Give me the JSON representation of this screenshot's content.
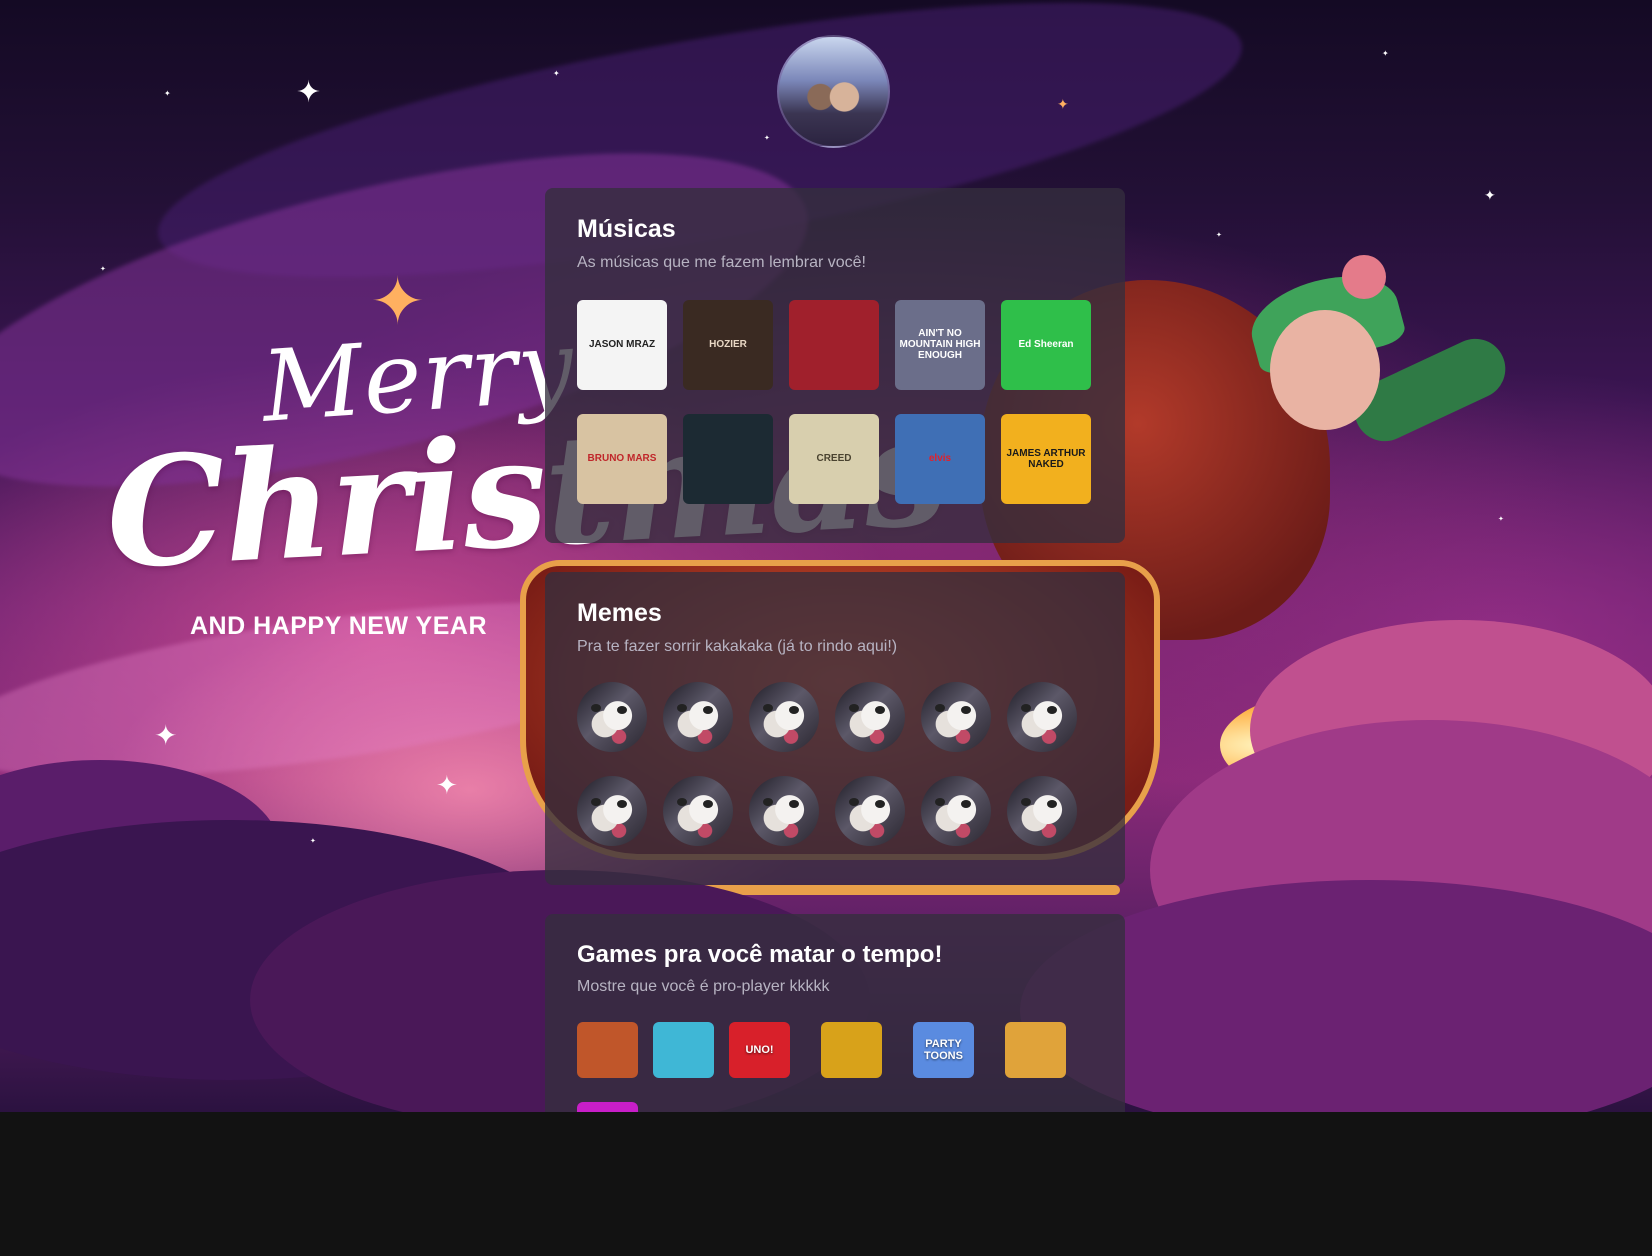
{
  "greeting": {
    "merry": "Merry",
    "christmas": "Christmas",
    "new_year": "AND HAPPY NEW YEAR"
  },
  "avatar": {
    "name": "avatar"
  },
  "musicas": {
    "title": "Músicas",
    "subtitle": "As músicas que me fazem lembrar você!",
    "albums": [
      {
        "label": "JASON MRAZ",
        "color": "#f4f4f4",
        "text_color": "#222222"
      },
      {
        "label": "HOZIER",
        "color": "#3a2a22",
        "text_color": "#e8d7c4"
      },
      {
        "label": "",
        "color": "#a0202c",
        "text_color": "#ffffff"
      },
      {
        "label": "AIN'T NO MOUNTAIN HIGH ENOUGH",
        "color": "#6b6e8a",
        "text_color": "#ffffff"
      },
      {
        "label": "Ed Sheeran",
        "color": "#2fbf4a",
        "text_color": "#ffffff"
      },
      {
        "label": "BRUNO MARS",
        "color": "#d8c3a2",
        "text_color": "#c0262a"
      },
      {
        "label": "",
        "color": "#1c2a33",
        "text_color": "#4aa3d6"
      },
      {
        "label": "CREED",
        "color": "#d8cfae",
        "text_color": "#4a4330"
      },
      {
        "label": "elvis",
        "color": "#3f6fb5",
        "text_color": "#e3202a"
      },
      {
        "label": "JAMES ARTHUR NAKED",
        "color": "#f2b01e",
        "text_color": "#1a1a1a"
      }
    ]
  },
  "memes": {
    "title": "Memes",
    "subtitle": "Pra te fazer sorrir kakakaka (já to rindo aqui!)",
    "items": [
      "meme",
      "meme",
      "meme",
      "meme",
      "meme",
      "meme",
      "meme",
      "meme",
      "meme",
      "meme",
      "meme",
      "meme"
    ]
  },
  "games": {
    "title": "Games pra você matar o tempo!",
    "subtitle": "Mostre que você é pro-player kkkkk",
    "row1": [
      {
        "label": "",
        "color": "#c0562a"
      },
      {
        "label": "",
        "color": "#3fb7d6"
      },
      {
        "label": "UNO!",
        "color": "#d8202a"
      },
      {
        "label": "",
        "color": "#d8a21a"
      },
      {
        "label": "PARTY TOONS",
        "color": "#5a8be0"
      },
      {
        "label": "",
        "color": "#e0a33a"
      }
    ],
    "row2": [
      {
        "label": "",
        "color": "#c81ec8"
      }
    ]
  }
}
